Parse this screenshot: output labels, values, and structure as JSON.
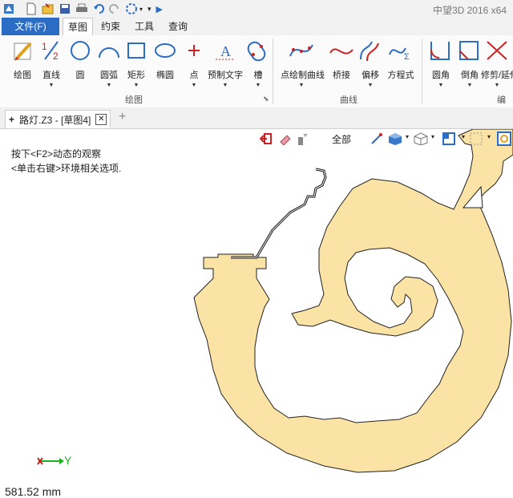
{
  "window": {
    "title": "中望3D 2016  x64"
  },
  "quick_access": {
    "icons": [
      "app-logo-icon",
      "new-file-icon",
      "open-file-icon",
      "save-icon",
      "print-icon",
      "undo-icon",
      "redo-icon",
      "selection-icon",
      "dropdown-icon",
      "play-icon"
    ]
  },
  "ribbon_tabs": {
    "file": "文件(F)",
    "sketch": "草图",
    "constraint": "约束",
    "tools": "工具",
    "query": "查询"
  },
  "ribbon": {
    "draw": "绘图",
    "line": "直线",
    "circle": "圆",
    "arc": "圆弧",
    "rect": "矩形",
    "ellipse": "椭圆",
    "point": "点",
    "preset_text": "预制文字",
    "slot": "槽",
    "point_curve": "点绘制曲线",
    "bridge": "桥接",
    "offset": "偏移",
    "equation": "方程式",
    "fillet": "圆角",
    "chamfer": "倒角",
    "trim": "修剪/延伸",
    "group_draw": "绘图",
    "group_curve": "曲线",
    "group_edit": "编辑"
  },
  "document": {
    "tab_label": "路灯.Z3 - [草图4]",
    "close": "✕",
    "new_tab": "+"
  },
  "canvas": {
    "hint_line1": "按下<F2>动态的观察",
    "hint_line2": "<单击右键>环境相关选项.",
    "view_filter": "全部",
    "axis_y": "Y",
    "measurement": "581.52 mm",
    "shape_fill": "#fbe3a6",
    "accent": "#2b6cc4"
  }
}
